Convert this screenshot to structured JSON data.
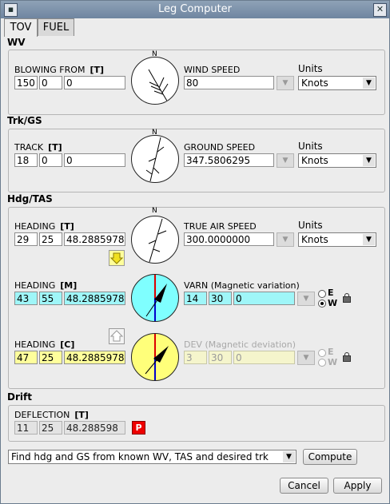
{
  "window": {
    "title": "Leg Computer"
  },
  "tabs": [
    {
      "label": "TOV"
    },
    {
      "label": "FUEL"
    }
  ],
  "compass_north": "N",
  "wv": {
    "section": "WV",
    "field_label": "BLOWING FROM",
    "ref": "[T]",
    "deg": "150",
    "min": "0",
    "sec": "0",
    "speed_label": "WIND SPEED",
    "speed": "80",
    "units_label": "Units",
    "units": "Knots"
  },
  "trk": {
    "section": "Trk/GS",
    "field_label": "TRACK",
    "ref": "[T]",
    "deg": "18",
    "min": "0",
    "sec": "0",
    "speed_label": "GROUND SPEED",
    "speed": "347.5806295",
    "units_label": "Units",
    "units": "Knots"
  },
  "hdg": {
    "section": "Hdg/TAS",
    "true_label": "HEADING",
    "true_ref": "[T]",
    "true_deg": "29",
    "true_min": "25",
    "true_sec": "48.2885978",
    "tas_label": "TRUE AIR SPEED",
    "tas": "300.0000000",
    "units_label": "Units",
    "units": "Knots",
    "mag_label": "HEADING",
    "mag_ref": "[M]",
    "mag_deg": "43",
    "mag_min": "55",
    "mag_sec": "48.2885978",
    "varn_label": "VARN (Magnetic variation)",
    "varn_deg": "14",
    "varn_min": "30",
    "varn_sec": "0",
    "varn_east": "E",
    "varn_west": "W",
    "comp_label": "HEADING",
    "comp_ref": "[C]",
    "comp_deg": "47",
    "comp_min": "25",
    "comp_sec": "48.2885978",
    "dev_label": "DEV (Magnetic deviation)",
    "dev_deg": "3",
    "dev_min": "30",
    "dev_sec": "0",
    "dev_east": "E",
    "dev_west": "W"
  },
  "drift": {
    "section": "Drift",
    "label": "DEFLECTION",
    "ref": "[T]",
    "deg": "11",
    "min": "25",
    "sec": "48.288598",
    "p_label": "P"
  },
  "mode": {
    "selected": "Find hdg and GS from known WV, TAS and desired trk",
    "compute_label": "Compute"
  },
  "footer": {
    "cancel_label": "Cancel",
    "apply_label": "Apply"
  },
  "colors": {
    "magnetic": "#7fffff",
    "compass": "#ffff7a",
    "danger": "#e00000"
  }
}
